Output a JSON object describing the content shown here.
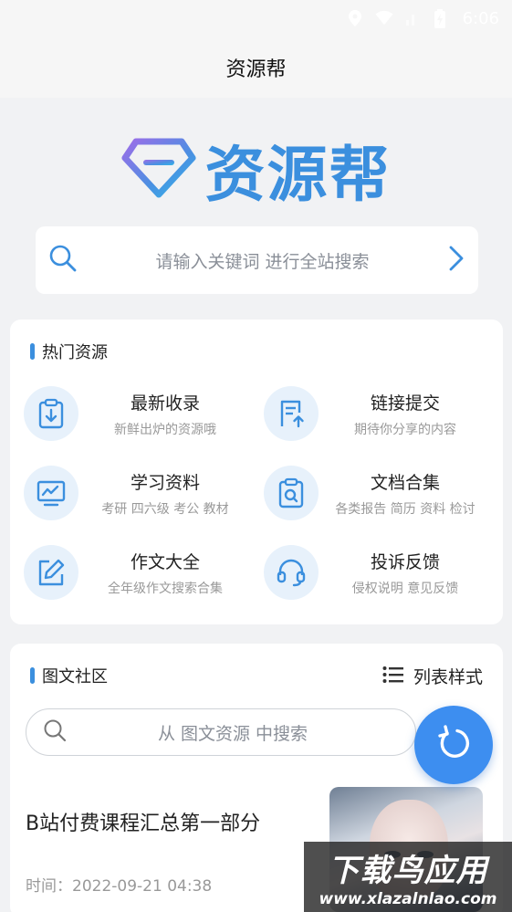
{
  "status_bar": {
    "time": "6:06"
  },
  "header": {
    "title": "资源帮"
  },
  "logo": {
    "text": "资源帮"
  },
  "search": {
    "placeholder": "请输入关键词 进行全站搜索"
  },
  "hot": {
    "title": "热门资源",
    "items": [
      {
        "label": "最新收录",
        "sub": "新鲜出炉的资源哦",
        "icon": "clipboard-download-icon"
      },
      {
        "label": "链接提交",
        "sub": "期待你分享的内容",
        "icon": "document-upload-icon"
      },
      {
        "label": "学习资料",
        "sub": "考研 四六级 考公 教材",
        "icon": "chart-monitor-icon"
      },
      {
        "label": "文档合集",
        "sub": "各类报告 简历 资料 检讨",
        "icon": "clipboard-search-icon"
      },
      {
        "label": "作文大全",
        "sub": "全年级作文搜索合集",
        "icon": "edit-icon"
      },
      {
        "label": "投诉反馈",
        "sub": "侵权说明 意见反馈",
        "icon": "headset-icon"
      }
    ]
  },
  "community": {
    "title": "图文社区",
    "list_style_label": "列表样式",
    "search_placeholder": "从 图文资源 中搜索",
    "post": {
      "title": "B站付费课程汇总第一部分",
      "time": "时间：2022-09-21 04:38"
    }
  },
  "watermark": {
    "line1": "下载鸟应用",
    "line2": "www.xlazalnlao.com"
  },
  "colors": {
    "accent": "#3b8fde",
    "fab": "#3d8ef0",
    "background": "#f1f2f4"
  }
}
